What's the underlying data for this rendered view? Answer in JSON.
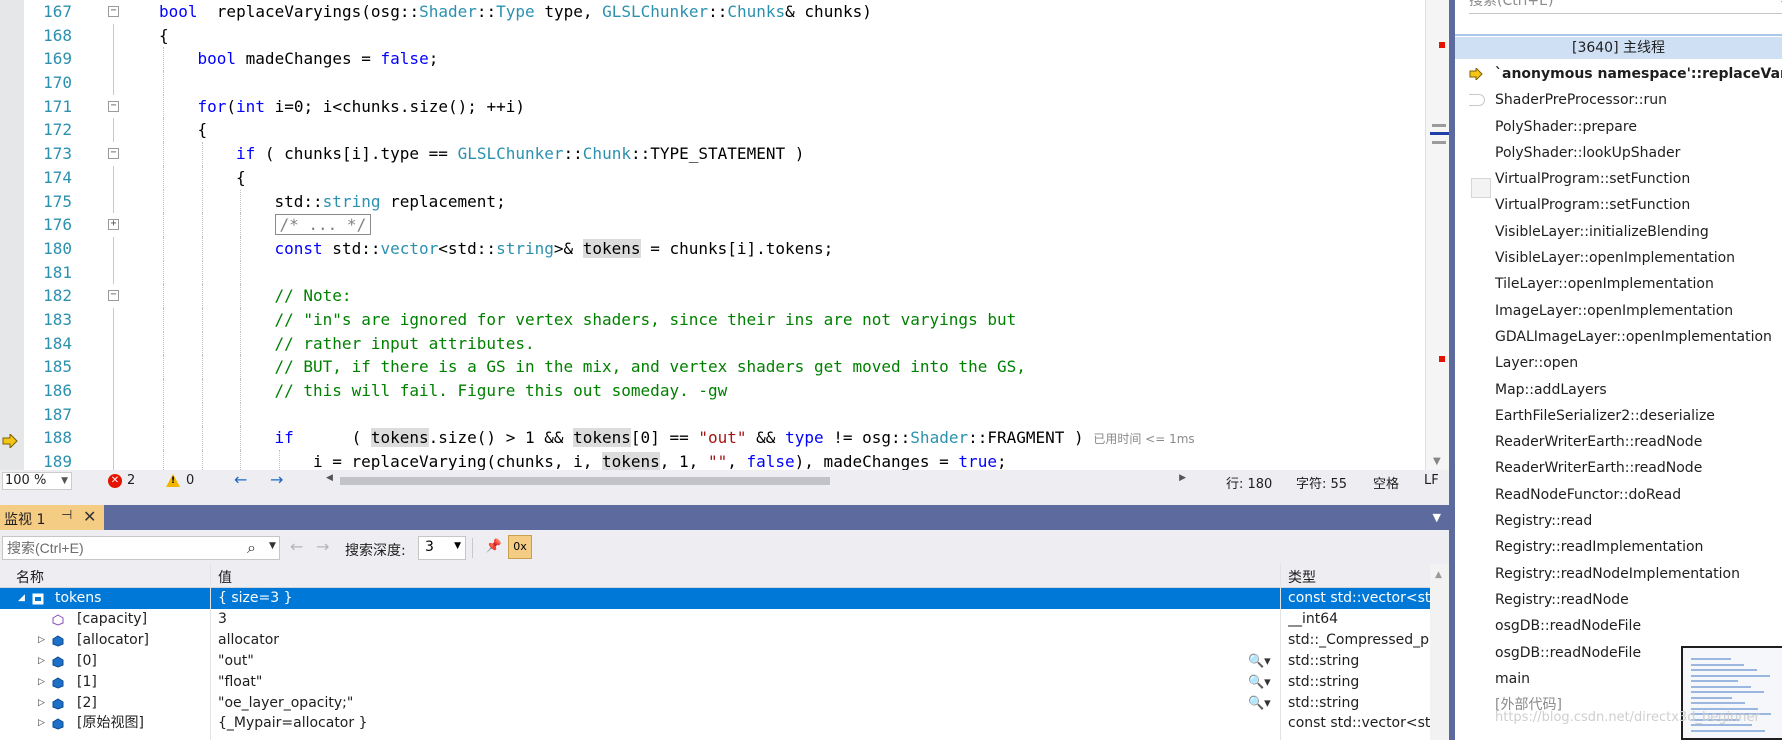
{
  "editor": {
    "lines": [
      {
        "num": "167",
        "fold": "minus",
        "indent": 0,
        "segments": [
          [
            "kw",
            "bool"
          ],
          [
            "",
            "  "
          ],
          [
            "",
            "replaceVaryings("
          ],
          [
            "",
            "osg::"
          ],
          [
            "ty",
            "Shader"
          ],
          [
            "",
            "::"
          ],
          [
            "ty",
            "Type"
          ],
          [
            "",
            " type, "
          ],
          [
            "ty",
            "GLSLChunker"
          ],
          [
            "",
            "::"
          ],
          [
            "ty",
            "Chunks"
          ],
          [
            "",
            "& chunks)"
          ]
        ]
      },
      {
        "num": "168",
        "fold": "line",
        "indent": 0,
        "segments": [
          [
            "",
            "{"
          ]
        ]
      },
      {
        "num": "169",
        "fold": "line",
        "indent": 1,
        "segments": [
          [
            "kw",
            "bool"
          ],
          [
            "",
            " madeChanges = "
          ],
          [
            "kw",
            "false"
          ],
          [
            "",
            ";"
          ]
        ]
      },
      {
        "num": "170",
        "fold": "line",
        "indent": 1,
        "segments": [
          [
            "",
            ""
          ]
        ]
      },
      {
        "num": "171",
        "fold": "minus",
        "indent": 1,
        "segments": [
          [
            "kw",
            "for"
          ],
          [
            "",
            "("
          ],
          [
            "kw",
            "int"
          ],
          [
            "",
            " i=0; i<chunks.size(); ++i)"
          ]
        ]
      },
      {
        "num": "172",
        "fold": "line",
        "indent": 1,
        "segments": [
          [
            "",
            "{"
          ]
        ]
      },
      {
        "num": "173",
        "fold": "minus",
        "indent": 2,
        "segments": [
          [
            "kw",
            "if"
          ],
          [
            "",
            " ( chunks[i].type == "
          ],
          [
            "ty",
            "GLSLChunker"
          ],
          [
            "",
            "::"
          ],
          [
            "ty",
            "Chunk"
          ],
          [
            "",
            "::TYPE_STATEMENT )"
          ]
        ]
      },
      {
        "num": "174",
        "fold": "line",
        "indent": 2,
        "segments": [
          [
            "",
            "{"
          ]
        ]
      },
      {
        "num": "175",
        "fold": "line",
        "indent": 3,
        "segments": [
          [
            "",
            "std::"
          ],
          [
            "ty",
            "string"
          ],
          [
            "",
            " replacement;"
          ]
        ]
      },
      {
        "num": "176",
        "fold": "plus",
        "indent": 3,
        "segments": [
          [
            "collapsed",
            "/* ... */"
          ]
        ]
      },
      {
        "num": "180",
        "fold": "line",
        "indent": 3,
        "segments": [
          [
            "kw",
            "const"
          ],
          [
            "",
            " std::"
          ],
          [
            "ty",
            "vector"
          ],
          [
            "",
            "<std::"
          ],
          [
            "ty",
            "string"
          ],
          [
            "",
            ">& "
          ],
          [
            "hl",
            "tokens"
          ],
          [
            "",
            " = chunks[i].tokens;"
          ]
        ]
      },
      {
        "num": "181",
        "fold": "line",
        "indent": 3,
        "segments": [
          [
            "",
            ""
          ]
        ]
      },
      {
        "num": "182",
        "fold": "minus",
        "indent": 3,
        "segments": [
          [
            "cm",
            "// Note:"
          ]
        ]
      },
      {
        "num": "183",
        "fold": "line",
        "indent": 3,
        "segments": [
          [
            "cm",
            "// \"in\"s are ignored for vertex shaders, since their ins are not varyings but"
          ]
        ]
      },
      {
        "num": "184",
        "fold": "line",
        "indent": 3,
        "segments": [
          [
            "cm",
            "// rather input attributes."
          ]
        ]
      },
      {
        "num": "185",
        "fold": "line",
        "indent": 3,
        "segments": [
          [
            "cm",
            "// BUT, if there is a GS in the mix, and vertex shaders get moved into the GS,"
          ]
        ]
      },
      {
        "num": "186",
        "fold": "line",
        "indent": 3,
        "segments": [
          [
            "cm",
            "// this will fail. Figure this out someday. -gw"
          ]
        ]
      },
      {
        "num": "187",
        "fold": "line",
        "indent": 3,
        "segments": [
          [
            "",
            ""
          ]
        ]
      },
      {
        "num": "188",
        "fold": "line",
        "indent": 3,
        "segments": [
          [
            "kw",
            "if"
          ],
          [
            "",
            "      ( "
          ],
          [
            "hl",
            "tokens"
          ],
          [
            "",
            ".size() > 1 && "
          ],
          [
            "hl",
            "tokens"
          ],
          [
            "",
            "[0] == "
          ],
          [
            "str",
            "\"out\""
          ],
          [
            "",
            " && "
          ],
          [
            "kw",
            "type"
          ],
          [
            "",
            " != osg::"
          ],
          [
            "ty",
            "Shader"
          ],
          [
            "",
            "::FRAGMENT ) "
          ],
          [
            "elapsed",
            "已用时间 <= 1ms"
          ]
        ]
      },
      {
        "num": "189",
        "fold": "line",
        "indent": 4,
        "segments": [
          [
            "",
            "i = replaceVarying(chunks, i, "
          ],
          [
            "hl",
            "tokens"
          ],
          [
            "",
            ", 1, "
          ],
          [
            "str",
            "\"\""
          ],
          [
            "",
            ", "
          ],
          [
            "kw",
            "false"
          ],
          [
            "",
            "), madeChanges = "
          ],
          [
            "kw",
            "true"
          ],
          [
            "",
            ";"
          ]
        ]
      }
    ]
  },
  "status": {
    "zoom": "100 %",
    "errors": "2",
    "warnings": "0",
    "row": "行: 180",
    "col": "字符: 55",
    "indent_mode": "空格",
    "eol": "LF"
  },
  "watch": {
    "tab_label": "监视 1",
    "search_placeholder": "搜索(Ctrl+E)",
    "depth_label": "搜索深度:",
    "depth_value": "3",
    "columns": {
      "name": "名称",
      "value": "值",
      "type": "类型"
    },
    "rows": [
      {
        "expander": "◢",
        "level": 0,
        "icon": "watch-var",
        "name": "tokens",
        "value": "{ size=3 }",
        "type": "const std::vector<st...",
        "selected": true,
        "magnifier": false
      },
      {
        "expander": "",
        "level": 1,
        "icon": "property",
        "name": "[capacity]",
        "value": "3",
        "type": "__int64",
        "selected": false,
        "magnifier": false
      },
      {
        "expander": "▷",
        "level": 1,
        "icon": "field",
        "name": "[allocator]",
        "value": "allocator",
        "type": "std::_Compressed_p...",
        "selected": false,
        "magnifier": false
      },
      {
        "expander": "▷",
        "level": 1,
        "icon": "field",
        "name": "[0]",
        "value": "\"out\"",
        "type": "std::string",
        "selected": false,
        "magnifier": true
      },
      {
        "expander": "▷",
        "level": 1,
        "icon": "field",
        "name": "[1]",
        "value": "\"float\"",
        "type": "std::string",
        "selected": false,
        "magnifier": true
      },
      {
        "expander": "▷",
        "level": 1,
        "icon": "field",
        "name": "[2]",
        "value": "\"oe_layer_opacity;\"",
        "type": "std::string",
        "selected": false,
        "magnifier": true
      },
      {
        "expander": "▷",
        "level": 1,
        "icon": "field",
        "name": "[原始视图]",
        "value": "{_Mypair=allocator }",
        "type": "const std::vector<st...",
        "selected": false,
        "magnifier": false
      }
    ]
  },
  "callstack": {
    "search_placeholder": "搜索(Ctrl+E)",
    "thread": "[3640] 主线程",
    "frames": [
      {
        "label": "`anonymous namespace'::replaceVaryings",
        "current": true,
        "external": false
      },
      {
        "label": "ShaderPreProcessor::run",
        "current": false,
        "external": false
      },
      {
        "label": "PolyShader::prepare",
        "current": false,
        "external": false
      },
      {
        "label": "PolyShader::lookUpShader",
        "current": false,
        "external": false
      },
      {
        "label": "VirtualProgram::setFunction",
        "current": false,
        "external": false
      },
      {
        "label": "VirtualProgram::setFunction",
        "current": false,
        "external": false
      },
      {
        "label": "VisibleLayer::initializeBlending",
        "current": false,
        "external": false
      },
      {
        "label": "VisibleLayer::openImplementation",
        "current": false,
        "external": false
      },
      {
        "label": "TileLayer::openImplementation",
        "current": false,
        "external": false
      },
      {
        "label": "ImageLayer::openImplementation",
        "current": false,
        "external": false
      },
      {
        "label": "GDALImageLayer::openImplementation",
        "current": false,
        "external": false
      },
      {
        "label": "Layer::open",
        "current": false,
        "external": false
      },
      {
        "label": "Map::addLayers",
        "current": false,
        "external": false
      },
      {
        "label": "EarthFileSerializer2::deserialize",
        "current": false,
        "external": false
      },
      {
        "label": "ReaderWriterEarth::readNode",
        "current": false,
        "external": false
      },
      {
        "label": "ReaderWriterEarth::readNode",
        "current": false,
        "external": false
      },
      {
        "label": "ReadNodeFunctor::doRead",
        "current": false,
        "external": false
      },
      {
        "label": "Registry::read",
        "current": false,
        "external": false
      },
      {
        "label": "Registry::readImplementation",
        "current": false,
        "external": false
      },
      {
        "label": "Registry::readNodeImplementation",
        "current": false,
        "external": false
      },
      {
        "label": "Registry::readNode",
        "current": false,
        "external": false
      },
      {
        "label": "osgDB::readNodeFile",
        "current": false,
        "external": false
      },
      {
        "label": "osgDB::readNodeFile",
        "current": false,
        "external": false
      },
      {
        "label": "main",
        "current": false,
        "external": false
      },
      {
        "label": "[外部代码]",
        "current": false,
        "external": true
      }
    ],
    "watermark": "https://blog.csdn.net/directx3d_beginner"
  },
  "colors": {
    "keyword": "#0000ff",
    "type": "#2b91af",
    "string": "#a31515",
    "comment": "#008000",
    "selection": "#0078d7",
    "panel_header": "#5c6a9e",
    "active_tab": "#f5cc84"
  }
}
